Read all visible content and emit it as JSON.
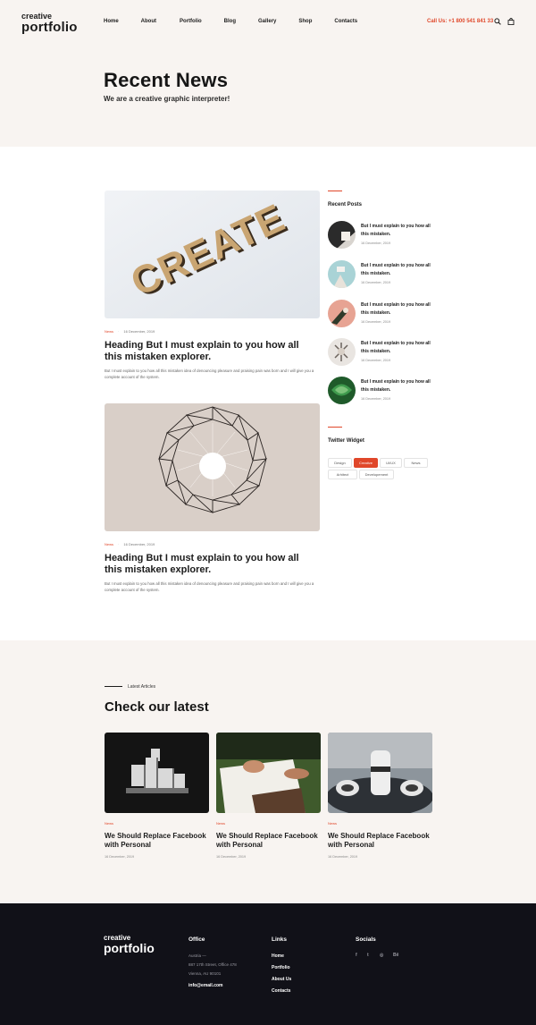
{
  "header": {
    "logo_small": "creative",
    "logo_big": "portfolio",
    "nav": [
      "Home",
      "About",
      "Portfolio",
      "Blog",
      "Gallery",
      "Shop",
      "Contacts"
    ],
    "call": "Call Us: +1 800 541 841 33",
    "icons": [
      "search-icon",
      "shopping-bag-icon"
    ]
  },
  "hero": {
    "title": "Recent News",
    "subtitle": "We are a creative graphic interpreter!"
  },
  "posts": [
    {
      "image_text": "CREATE",
      "category": "News",
      "date": "16 December, 2019",
      "title": "Heading But I must explain to you how all this mistaken explorer.",
      "text": "But I must explain to you how all this mistaken idea of denouncing pleasure and praising pain was born and I will give you a complete account of the system."
    },
    {
      "category": "News",
      "date": "16 December, 2019",
      "title": "Heading But I must explain to you how all this mistaken explorer.",
      "text": "But I must explain to you how all this mistaken idea of denouncing pleasure and praising pain was born and I will give you a complete account of the system."
    }
  ],
  "sidebar": {
    "recent_title": "Recent Posts",
    "recent_posts": [
      {
        "title": "But I must explain to you how all this mistaken.",
        "date": "16 December, 2019"
      },
      {
        "title": "But I must explain to you how all this mistaken.",
        "date": "16 December, 2019"
      },
      {
        "title": "But I must explain to you how all this mistaken.",
        "date": "16 December, 2019"
      },
      {
        "title": "But I must explain to you how all this mistaken.",
        "date": "16 December, 2019"
      },
      {
        "title": "But I must explain to you how all this mistaken.",
        "date": "16 December, 2019"
      }
    ],
    "widget_title": "Twitter Widget",
    "tags": [
      "Design",
      "Creative",
      "UI/UX",
      "News",
      "Arhitect",
      "Developement"
    ],
    "active_tag": "Creative"
  },
  "latest": {
    "label": "Latest Articles",
    "title": "Check our latest",
    "cards": [
      {
        "category": "News",
        "title": "We Should Replace Facebook with Personal",
        "date": "16 December, 2019"
      },
      {
        "category": "News",
        "title": "We Should Replace Facebook with Personal",
        "date": "16 December, 2019"
      },
      {
        "category": "News",
        "title": "We Should Replace Facebook with Personal",
        "date": "16 December, 2019"
      }
    ]
  },
  "footer": {
    "logo_small": "creative",
    "logo_big": "portfolio",
    "office_title": "Office",
    "office_lines": [
      "Austria —",
      "887 17th Street, Office 478",
      "Vienna, AU 90101"
    ],
    "email": "info@email.com",
    "links_title": "Links",
    "links": [
      "Home",
      "Portfolio",
      "About Us",
      "Contacts"
    ],
    "socials_title": "Socials",
    "socials": [
      {
        "icon": "facebook-icon",
        "glyph": "f"
      },
      {
        "icon": "twitter-icon",
        "glyph": "t"
      },
      {
        "icon": "dribbble-icon",
        "glyph": "◎"
      },
      {
        "icon": "behance-icon",
        "glyph": "Bē"
      }
    ]
  },
  "colors": {
    "accent": "#e0472a",
    "cream": "#f8f4f1",
    "dark": "#111118"
  }
}
